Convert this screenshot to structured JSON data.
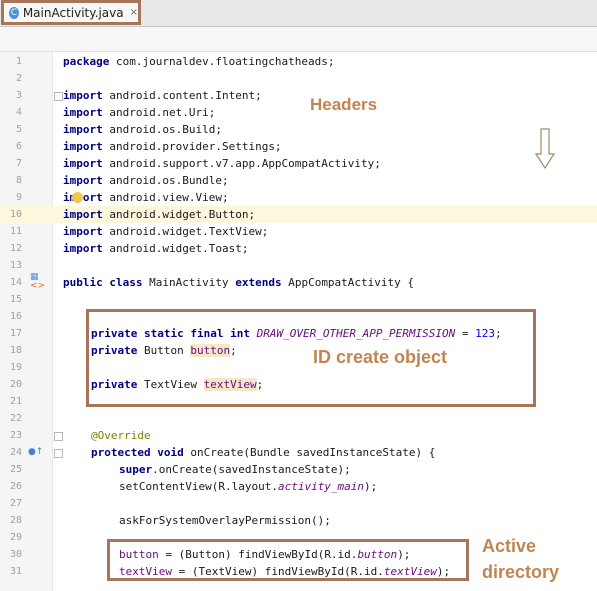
{
  "tab": {
    "icon": "class-c-icon",
    "icon_letter": "C",
    "filename": "MainActivity.java",
    "close": "×"
  },
  "annotations": {
    "headers": "Headers",
    "id_create": "ID create object",
    "active_line1": "Active",
    "active_line2": "directory"
  },
  "lines": [
    {
      "n": "1",
      "text": "package com.journaldev.floatingchatheads;"
    },
    {
      "n": "2",
      "text": ""
    },
    {
      "n": "3",
      "text": "import android.content.Intent;"
    },
    {
      "n": "4",
      "text": "import android.net.Uri;"
    },
    {
      "n": "5",
      "text": "import android.os.Build;"
    },
    {
      "n": "6",
      "text": "import android.provider.Settings;"
    },
    {
      "n": "7",
      "text": "import android.support.v7.app.AppCompatActivity;"
    },
    {
      "n": "8",
      "text": "import android.os.Bundle;"
    },
    {
      "n": "9",
      "text": "import android.view.View;"
    },
    {
      "n": "10",
      "text": "import android.widget.Button;"
    },
    {
      "n": "11",
      "text": "import android.widget.TextView;"
    },
    {
      "n": "12",
      "text": "import android.widget.Toast;"
    },
    {
      "n": "13",
      "text": ""
    },
    {
      "n": "14",
      "text": "public class MainActivity extends AppCompatActivity {"
    },
    {
      "n": "15",
      "text": ""
    },
    {
      "n": "16",
      "text": ""
    },
    {
      "n": "17",
      "text": "private static final int DRAW_OVER_OTHER_APP_PERMISSION = 123;"
    },
    {
      "n": "18",
      "text": "private Button button;"
    },
    {
      "n": "19",
      "text": ""
    },
    {
      "n": "20",
      "text": "private TextView textView;"
    },
    {
      "n": "21",
      "text": ""
    },
    {
      "n": "22",
      "text": ""
    },
    {
      "n": "23",
      "text": "@Override"
    },
    {
      "n": "24",
      "text": "protected void onCreate(Bundle savedInstanceState) {"
    },
    {
      "n": "25",
      "text": "super.onCreate(savedInstanceState);"
    },
    {
      "n": "26",
      "text": "setContentView(R.layout.activity_main);"
    },
    {
      "n": "27",
      "text": ""
    },
    {
      "n": "28",
      "text": "askForSystemOverlayPermission();"
    },
    {
      "n": "29",
      "text": ""
    },
    {
      "n": "30",
      "text": "button = (Button) findViewById(R.id.button);"
    },
    {
      "n": "31",
      "text": "textView = (TextView) findViewById(R.id.textView);"
    }
  ],
  "colors": {
    "accent_box": "#a9755a",
    "label": "#c08552",
    "keyword": "#000080",
    "highlight_line": "#fdf7dd"
  }
}
